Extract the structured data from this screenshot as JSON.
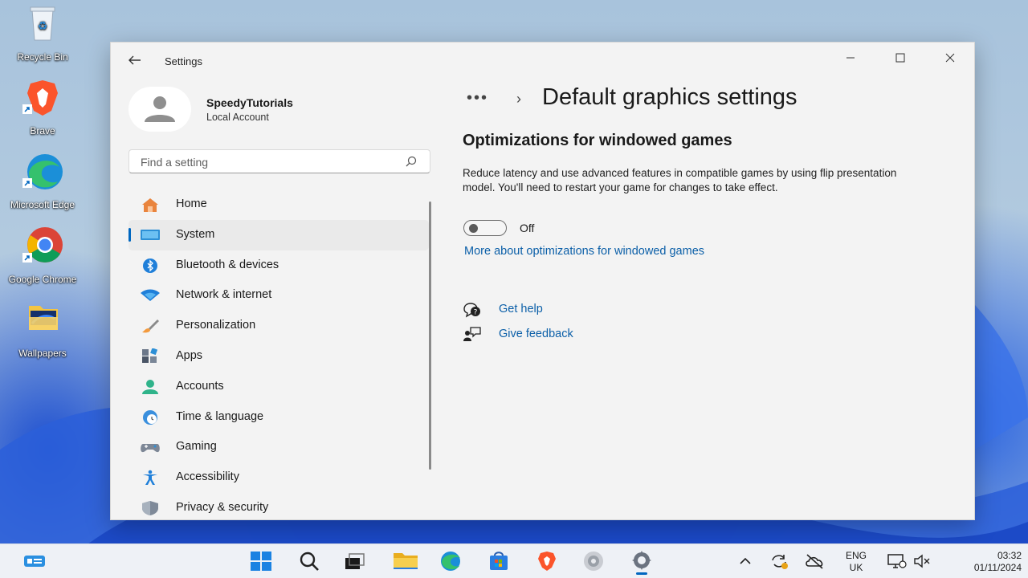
{
  "desktop": {
    "icons": [
      {
        "label": "Recycle Bin"
      },
      {
        "label": "Brave"
      },
      {
        "label": "Microsoft Edge"
      },
      {
        "label": "Google Chrome"
      },
      {
        "label": "Wallpapers"
      }
    ]
  },
  "window": {
    "title": "Settings",
    "back_icon": "arrow-left-icon",
    "controls": [
      "minimize",
      "maximize",
      "close"
    ]
  },
  "profile": {
    "name": "SpeedyTutorials",
    "account_type": "Local Account"
  },
  "search": {
    "placeholder": "Find a setting"
  },
  "nav": {
    "items": [
      {
        "label": "Home",
        "icon": "home-icon"
      },
      {
        "label": "System",
        "icon": "system-icon",
        "active": true
      },
      {
        "label": "Bluetooth & devices",
        "icon": "bluetooth-icon"
      },
      {
        "label": "Network & internet",
        "icon": "wifi-icon"
      },
      {
        "label": "Personalization",
        "icon": "brush-icon"
      },
      {
        "label": "Apps",
        "icon": "apps-icon"
      },
      {
        "label": "Accounts",
        "icon": "accounts-icon"
      },
      {
        "label": "Time & language",
        "icon": "clock-globe-icon"
      },
      {
        "label": "Gaming",
        "icon": "gamepad-icon"
      },
      {
        "label": "Accessibility",
        "icon": "accessibility-icon"
      },
      {
        "label": "Privacy & security",
        "icon": "shield-icon"
      }
    ]
  },
  "main": {
    "breadcrumb_dots": "•••",
    "breadcrumb_chevron": "›",
    "page_title": "Default graphics settings",
    "section_title": "Optimizations for windowed games",
    "description": "Reduce latency and use advanced features in compatible games by using flip presentation model. You'll need to restart your game for changes to take effect.",
    "toggle_state": "Off",
    "toggle_on": false,
    "more_link": "More about optimizations for windowed games",
    "help_links": [
      {
        "label": "Get help",
        "icon": "help-icon"
      },
      {
        "label": "Give feedback",
        "icon": "feedback-icon"
      }
    ]
  },
  "taskbar": {
    "language_line1": "ENG",
    "language_line2": "UK",
    "time": "03:32",
    "date": "01/11/2024"
  },
  "colors": {
    "accent": "#0067c0",
    "link": "#0b5fa8"
  }
}
